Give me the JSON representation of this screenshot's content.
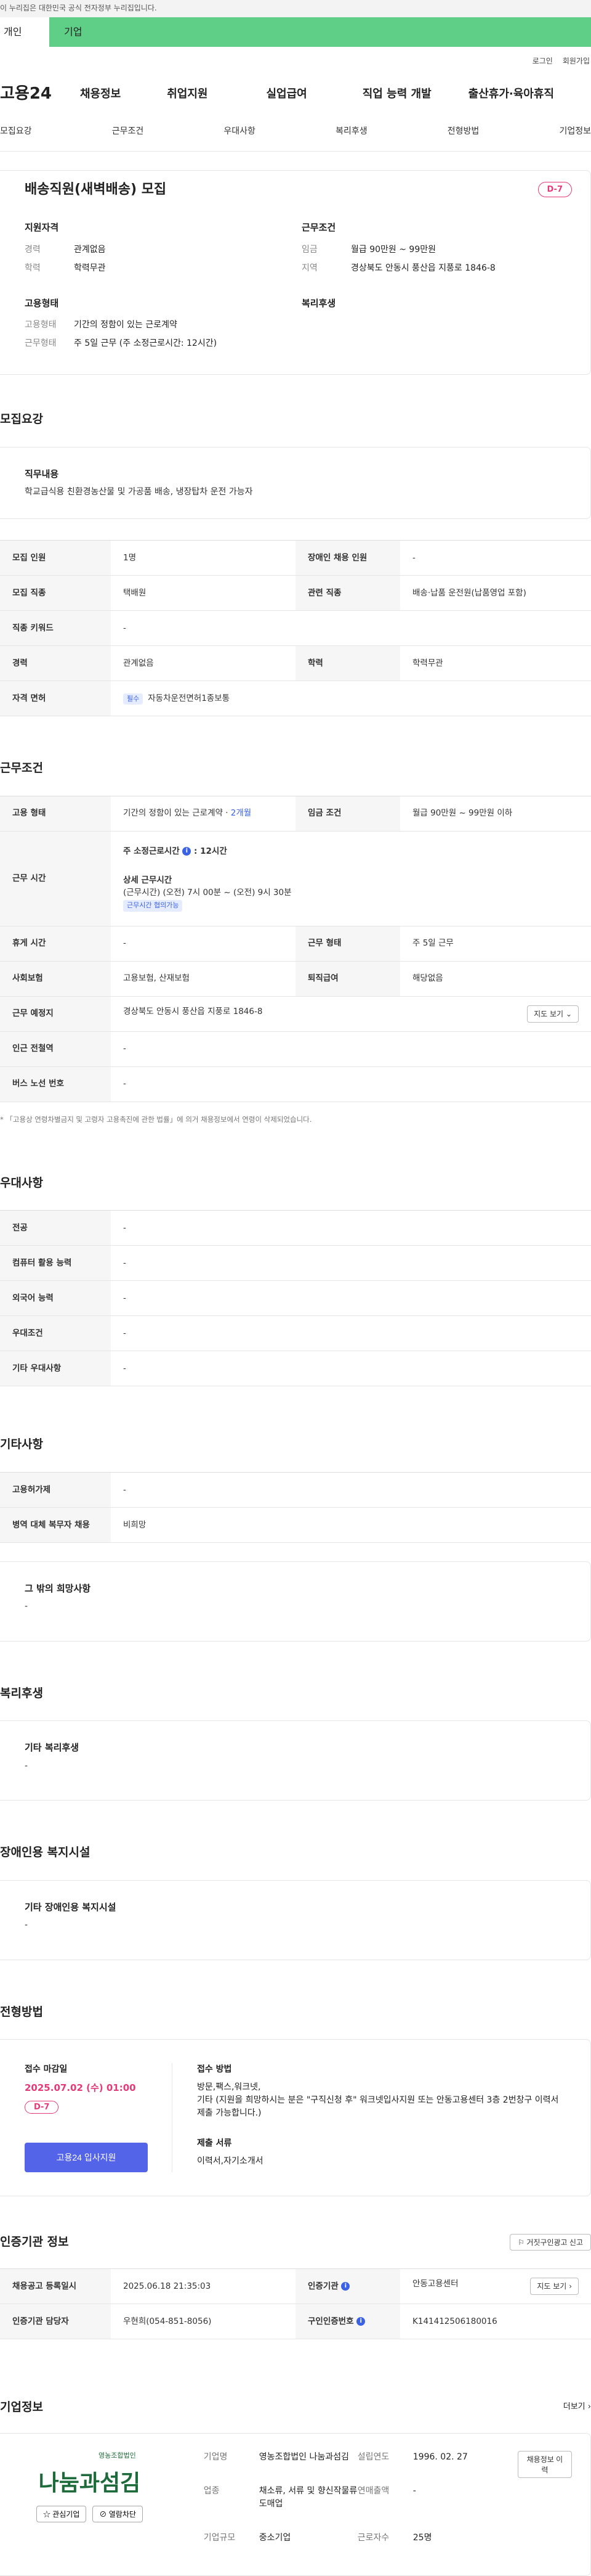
{
  "gov_banner": "이 누리집은 대한민국 공식 전자정부 누리집입니다.",
  "user_tabs": [
    "개인",
    "기업"
  ],
  "util": [
    "로그인",
    "회원가입"
  ],
  "logo": "고용24",
  "gnb": [
    "채용정보",
    "취업지원",
    "실업급여",
    "직업 능력 개발",
    "출산휴가·육아휴직"
  ],
  "tabs": [
    "모집요강",
    "근무조건",
    "우대사항",
    "복리후생",
    "전형방법",
    "기업정보"
  ],
  "summary": {
    "title": "배송직원(새벽배송) 모집",
    "dday": "D-7",
    "qual_title": "지원자격",
    "qual": [
      {
        "k": "경력",
        "v": "관계없음"
      },
      {
        "k": "학력",
        "v": "학력무관"
      }
    ],
    "cond_title": "근무조건",
    "cond": [
      {
        "k": "임금",
        "v": "월급 90만원 ~ 99만원"
      },
      {
        "k": "지역",
        "v": "경상북도 안동시 풍산읍 지풍로 1846-8"
      }
    ],
    "emp_title": "고용형태",
    "emp": [
      {
        "k": "고용형태",
        "v": "기간의 정함이 있는 근로계약"
      },
      {
        "k": "근무형태",
        "v": "주 5일 근무 (주 소정근로시간: 12시간)"
      }
    ],
    "welfare_title": "복리후생"
  },
  "recruit": {
    "title": "모집요강",
    "duty_label": "직무내용",
    "duty": "학교급식용 친환경농산물 및 가공품 배송, 냉장탑차 운전 가능자",
    "rows": [
      {
        "k1": "모집 인원",
        "v1": "1명",
        "k2": "장애인 채용 인원",
        "v2": "-"
      },
      {
        "k1": "모집 직종",
        "v1": "택배원",
        "k2": "관련 직종",
        "v2": "배송·납품 운전원(납품영업 포함)"
      },
      {
        "k1": "직종 키워드",
        "v1": "-"
      },
      {
        "k1": "경력",
        "v1": "관계없음",
        "k2": "학력",
        "v2": "학력무관"
      },
      {
        "k1": "자격 면허",
        "v1": "자동차운전면허1종보통",
        "badge": "필수"
      }
    ]
  },
  "work": {
    "title": "근무조건",
    "emp_k": "고용 형태",
    "emp_v": "기간의 정함이 있는 근로계약 · ",
    "emp_period": "2개월",
    "wage_k": "임금 조건",
    "wage_v": "월급 90만원 ~ 99만원 이하",
    "time_k": "근무 시간",
    "time_h": "주 소정근로시간",
    "time_hv": ": 12시간",
    "time_detail": "상세 근무시간",
    "time_d": "(근무시간) (오전) 7시 00분 ~ (오전) 9시 30분",
    "time_badge": "근무시간 협의가능",
    "rest_k": "휴게 시간",
    "rest_v": "-",
    "type_k": "근무 형태",
    "type_v": "주 5일 근무",
    "ins_k": "사회보험",
    "ins_v": "고용보험, 산재보험",
    "sev_k": "퇴직급여",
    "sev_v": "해당없음",
    "place_k": "근무 예정지",
    "place_v": "경상북도 안동시 풍산읍 지풍로 1846-8",
    "map_btn": "지도 보기",
    "subway_k": "인근 전철역",
    "subway_v": "-",
    "bus_k": "버스 노선 번호",
    "bus_v": "-",
    "note": "* 「고용상 연령차별금지 및 고령자 고용촉진에 관한 법률」에 의거 채용정보에서 연령이 삭제되었습니다."
  },
  "pref": {
    "title": "우대사항",
    "rows": [
      {
        "k": "전공",
        "v": "-"
      },
      {
        "k": "컴퓨터 활용 능력",
        "v": "-"
      },
      {
        "k": "외국어 능력",
        "v": "-"
      },
      {
        "k": "우대조건",
        "v": "-"
      },
      {
        "k": "기타 우대사항",
        "v": "-"
      }
    ]
  },
  "etc": {
    "title": "기타사항",
    "rows": [
      {
        "k": "고용허가제",
        "v": "-"
      },
      {
        "k": "병역 대체 복무자 채용",
        "v": "비희망"
      }
    ],
    "other_label": "그 밖의 희망사항",
    "other_v": "-"
  },
  "welfare": {
    "title": "복리후생",
    "label": "기타 복리후생",
    "v": "-"
  },
  "disab": {
    "title": "장애인용 복지시설",
    "label": "기타 장애인용 복지시설",
    "v": "-"
  },
  "apply": {
    "title": "전형방법",
    "deadline_label": "접수 마감일",
    "deadline": "2025.07.02 (수) 01:00",
    "dday": "D-7",
    "btn": "고용24 입사지원",
    "method_label": "접수 방법",
    "method1": "방문,팩스,워크넷,",
    "method2": "기타 (지원을 희망하시는 분은 \"구직신청 후\" 워크넷입사지원 또는 안동고용센터 3층 2번창구 이력서 제출 가능합니다.)",
    "docs_label": "제출 서류",
    "docs": "이력서,자기소개서"
  },
  "cert": {
    "title": "인증기관 정보",
    "report_btn": "거짓구인광고 신고",
    "reg_k": "채용공고 등록일시",
    "reg_v": "2025.06.18 21:35:03",
    "org_k": "인증기관",
    "org_v": "안동고용센터",
    "detail_btn": "지도 보기",
    "mgr_k": "인증기관 담당자",
    "mgr_v": "우현희(054-851-8056)",
    "id_k": "구인인증번호",
    "id_v": "K141412506180016"
  },
  "company": {
    "title": "기업정보",
    "more": "더보기",
    "logo_small": "영농조합법인",
    "logo_text": "나눔과섬김",
    "fav_btn": "관심기업",
    "block_btn": "열람차단",
    "name_k": "기업명",
    "name_v": "영농조합법인 나눔과섬김",
    "ind_k": "업종",
    "ind_v": "채소류, 서류 및 향신작물류 도매업",
    "size_k": "기업규모",
    "size_v": "중소기업",
    "est_k": "설립연도",
    "est_v": "1996. 02. 27",
    "sales_k": "연매출액",
    "sales_v": "-",
    "emp_k": "근로자수",
    "emp_v": "25명",
    "history_btn": "채용정보 이력"
  }
}
